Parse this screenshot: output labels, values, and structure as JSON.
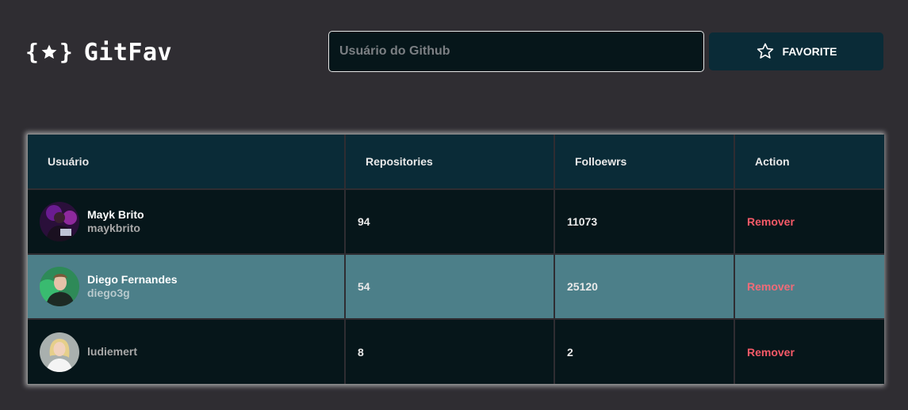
{
  "header": {
    "logo_text": "GitFav",
    "logo_icon": "braces-star-icon",
    "search": {
      "placeholder": "Usuário do Github",
      "value": ""
    },
    "favorite_label": "FAVORITE",
    "favorite_icon": "star-outline-icon"
  },
  "table": {
    "columns": [
      "Usuário",
      "Repositories",
      "Folloewrs",
      "Action"
    ],
    "rows": [
      {
        "name": "Mayk Brito",
        "login": "maykbrito",
        "repositories": "94",
        "followers": "11073",
        "action": "Remover",
        "avatar_icon": "avatar-photo-mayk"
      },
      {
        "name": "Diego Fernandes",
        "login": "diego3g",
        "repositories": "54",
        "followers": "25120",
        "action": "Remover",
        "avatar_icon": "avatar-photo-diego"
      },
      {
        "name": "",
        "login": "ludiemert",
        "repositories": "8",
        "followers": "2",
        "action": "Remover",
        "avatar_icon": "avatar-photo-ludiemert"
      }
    ]
  },
  "colors": {
    "background": "#2f2d32",
    "header_row": "#0a2b37",
    "row_dark": "#06161a",
    "row_highlight": "#4c7f89",
    "remove": "#f75a68"
  }
}
